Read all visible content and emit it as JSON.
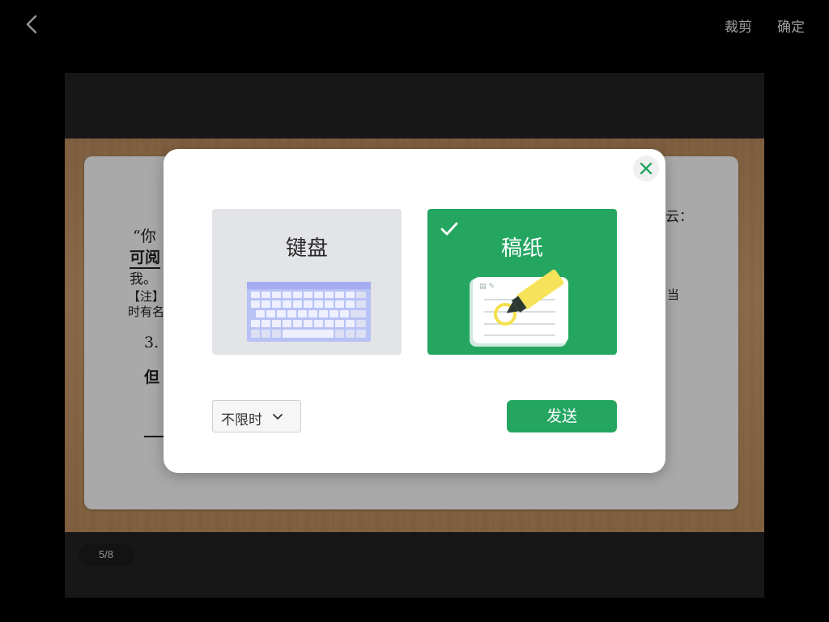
{
  "header": {
    "back_icon": "chevron-left-icon",
    "crop_label": "裁剪",
    "confirm_label": "确定"
  },
  "photo": {
    "visible_text": {
      "line1": "“你",
      "line2": "可阅",
      "line3": "我。",
      "line4": "【注】",
      "line5": "时有名",
      "line6": "3.",
      "line7": "但",
      "right1": "云：",
      "right2": "当"
    },
    "page_indicator": "5/8"
  },
  "modal": {
    "close_icon": "close-icon",
    "options": [
      {
        "label": "键盘",
        "icon": "keyboard-illustration",
        "selected": false
      },
      {
        "label": "稿纸",
        "icon": "draft-paper-highlighter-illustration",
        "selected": true
      }
    ],
    "selected_check_icon": "checkmark-icon",
    "time_select": {
      "value": "不限时",
      "icon": "chevron-down-icon"
    },
    "send_label": "发送"
  },
  "colors": {
    "accent_green": "#24a661",
    "keyboard_card_bg": "#e3e4e8",
    "keyboard_illustration": "#b9c2f5"
  }
}
